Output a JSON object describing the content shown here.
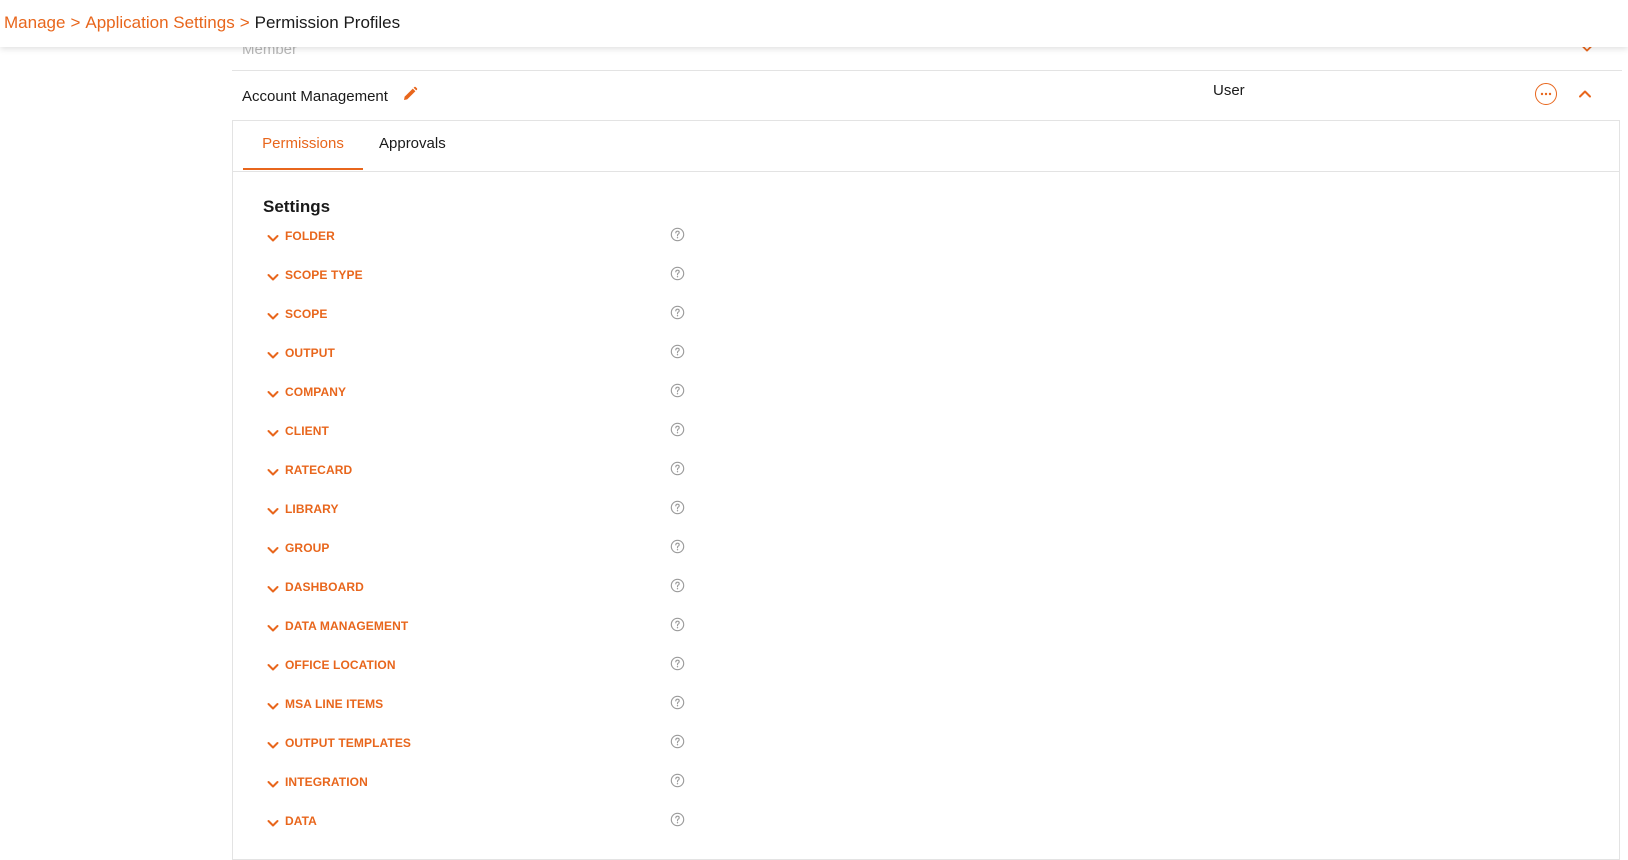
{
  "breadcrumb": {
    "items": [
      "Manage",
      "Application Settings"
    ],
    "separator": ">",
    "current": "Permission Profiles"
  },
  "previous_row": {
    "label": "Member"
  },
  "profile": {
    "name": "Account Management",
    "role": "User"
  },
  "tabs": [
    {
      "label": "Permissions",
      "active": true
    },
    {
      "label": "Approvals",
      "active": false
    }
  ],
  "settings": {
    "title": "Settings",
    "items": [
      "FOLDER",
      "SCOPE TYPE",
      "SCOPE",
      "OUTPUT",
      "COMPANY",
      "CLIENT",
      "RATECARD",
      "LIBRARY",
      "GROUP",
      "DASHBOARD",
      "DATA MANAGEMENT",
      "OFFICE LOCATION",
      "MSA LINE ITEMS",
      "OUTPUT TEMPLATES",
      "INTEGRATION",
      "DATA"
    ]
  },
  "icons": {
    "edit": "pencil-icon",
    "more": "ellipsis-icon",
    "collapse": "chevron-up-icon",
    "expand": "chevron-down-icon",
    "help": "question-circle-icon"
  },
  "colors": {
    "accent": "#e8661c",
    "text": "#1a1a1a",
    "muted": "#b8b8b8",
    "border": "#e3e3e3",
    "help_icon": "#9a9a9a"
  }
}
